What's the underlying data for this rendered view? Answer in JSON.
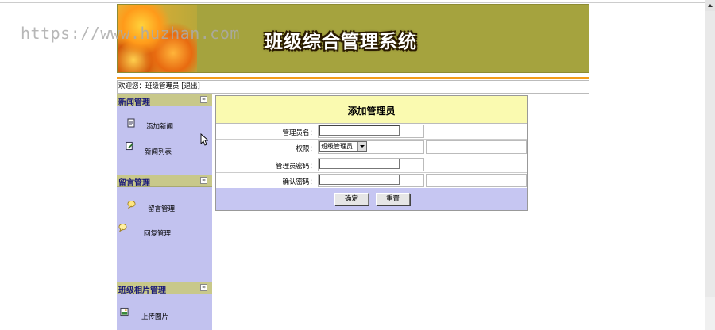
{
  "watermark": "https://www.huzhan.com",
  "banner": {
    "title": "班级综合管理系统"
  },
  "welcome": {
    "prefix": "欢迎您：班级管理员",
    "logout": "[退出]"
  },
  "sidebar": {
    "sections": [
      {
        "title": "新闻管理",
        "toggle": "≈",
        "items": [
          {
            "label": "添加新闻"
          },
          {
            "label": "新闻列表"
          }
        ]
      },
      {
        "title": "留言管理",
        "toggle": "≈",
        "items": [
          {
            "label": "留言管理"
          },
          {
            "label": "回复管理"
          }
        ]
      },
      {
        "title": "班级相片管理",
        "toggle": "≈",
        "items": [
          {
            "label": "上传图片"
          }
        ]
      }
    ]
  },
  "form": {
    "title": "添加管理员",
    "fields": {
      "username_label": "管理员名：",
      "role_label": "权限：",
      "role_value": "班级管理员",
      "password_label": "管理员密码：",
      "confirm_label": "确认密码："
    },
    "buttons": {
      "submit": "确定",
      "reset": "重置"
    }
  },
  "colors": {
    "banner": "#a5a33e",
    "sidebar": "#c2c2ef",
    "section_header": "#c8c88a",
    "form_header": "#fafab0",
    "accent_line": "#f39c1a"
  }
}
